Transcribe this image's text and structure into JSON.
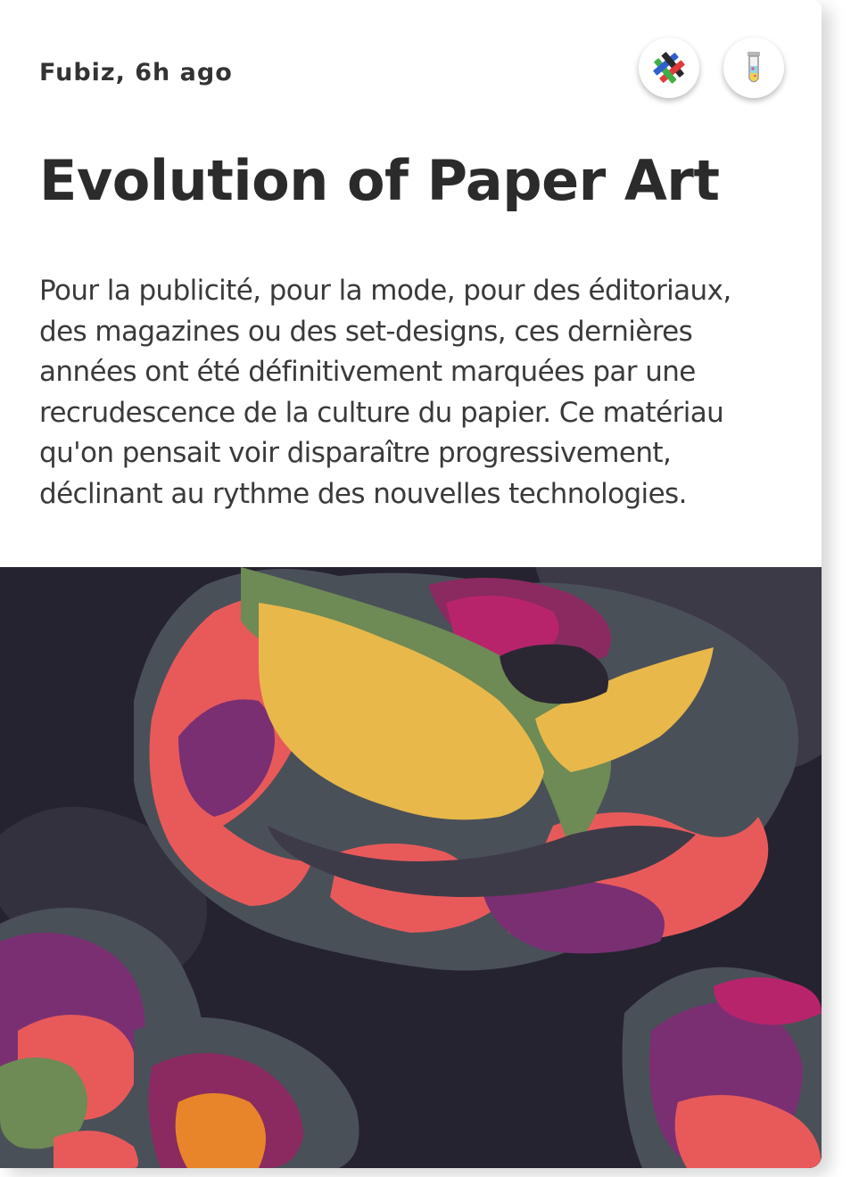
{
  "article": {
    "source_meta": "Fubiz, 6h ago",
    "title": "Evolution of Paper Art",
    "excerpt": "Pour la publicité, pour la mode, pour des éditoriaux, des magazines ou des set-designs, ces dernières années ont été définitivement marquées par une recrudescence de la culture du papier. Ce matériau qu'on pensait voir disparaître progressivement, déclinant au rythme des nouvelles technologies."
  },
  "actions": {
    "first_icon": "woven-cross-logo-icon",
    "second_icon": "test-tube-icon"
  },
  "hero_image": {
    "subject": "layered-paper-flower-art"
  },
  "colors": {
    "background": "#ffffff",
    "title_text": "#2b2b2b",
    "body_text": "#3a3a3a",
    "image_background": "#25232f",
    "paper_yellow": "#e8b84a",
    "paper_coral": "#e85a5a",
    "paper_purple": "#7a2f72",
    "paper_green": "#6e8a55",
    "paper_slate": "#4a5058"
  }
}
